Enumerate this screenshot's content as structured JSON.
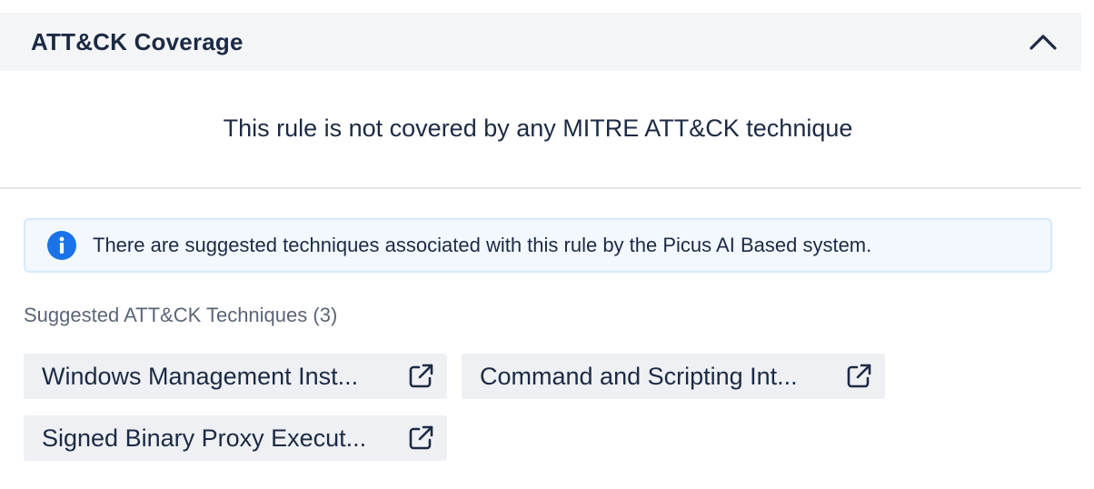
{
  "section": {
    "title": "ATT&CK Coverage",
    "collapse_icon": "chevron-up-icon"
  },
  "empty_message": "This rule is not covered by any MITRE ATT&CK technique",
  "info_banner": {
    "icon": "info-icon",
    "text": "There are suggested techniques associated with this rule by the Picus AI Based system.",
    "accent_color": "#1a73e8"
  },
  "suggested": {
    "label": "Suggested ATT&CK Techniques (3)",
    "techniques": [
      {
        "label": "Windows Management Inst...",
        "icon": "external-link-icon"
      },
      {
        "label": "Command and Scripting Int...",
        "icon": "external-link-icon"
      },
      {
        "label": "Signed Binary Proxy Execut...",
        "icon": "external-link-icon"
      }
    ]
  }
}
